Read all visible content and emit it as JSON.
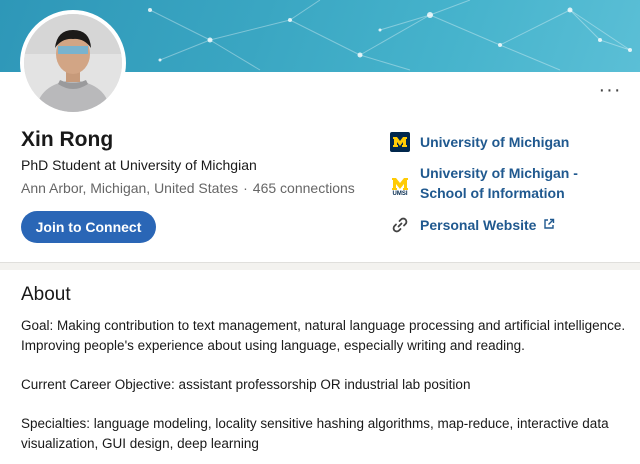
{
  "profile": {
    "name": "Xin Rong",
    "headline": "PhD Student at University of Michgian",
    "location": "Ann Arbor, Michigan, United States",
    "separator": "·",
    "connections": "465 connections",
    "more_label": "···"
  },
  "actions": {
    "connect_label": "Join to Connect"
  },
  "sidebar": {
    "items": [
      {
        "label": "University of Michigan",
        "icon": "university-of-michigan-logo-icon"
      },
      {
        "label": "University of Michigan - School of Information",
        "icon": "umsi-logo-icon",
        "logo_text": "UMSI"
      },
      {
        "label": "Personal Website",
        "icon": "link-icon",
        "suffix_icon": "external-link-icon"
      }
    ]
  },
  "about": {
    "title": "About",
    "paragraphs": [
      "Goal: Making contribution to text management, natural language processing and artificial intelligence. Improving people's experience about using language, especially writing and reading.",
      "Current Career Objective: assistant professorship OR industrial lab position",
      "Specialties: language modeling, locality sensitive hashing algorithms, map-reduce, interactive data visualization, GUI design, deep learning"
    ]
  },
  "colors": {
    "accent": "#2a66b6",
    "link": "#20598f",
    "michigan_blue": "#00274c",
    "michigan_maize": "#ffcb05"
  }
}
